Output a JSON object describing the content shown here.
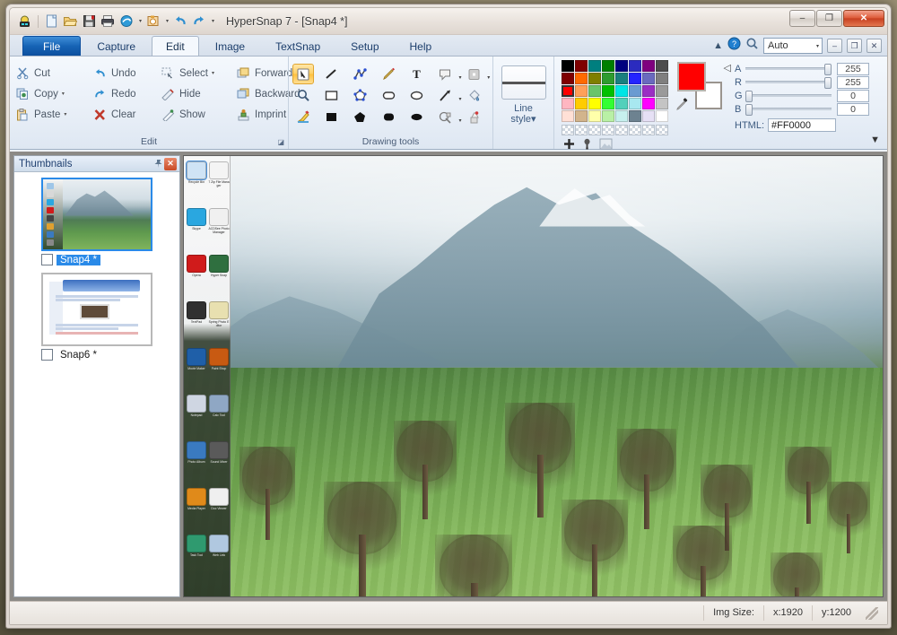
{
  "window": {
    "title": "HyperSnap 7 - [Snap4 *]",
    "app_icon": "hypersnap-app-icon",
    "buttons": {
      "minimize": "–",
      "maximize": "❐",
      "close": "✕"
    }
  },
  "quick_access": [
    {
      "name": "new-icon",
      "glyph": "📄"
    },
    {
      "name": "open-icon",
      "glyph": "📂"
    },
    {
      "name": "save-icon",
      "glyph": "💾"
    },
    {
      "name": "print-icon",
      "glyph": "🖨"
    },
    {
      "name": "capture-window-icon",
      "glyph": "🔵",
      "dropdown": true
    },
    {
      "name": "capture-region-icon",
      "glyph": "🟠",
      "dropdown": true
    },
    {
      "name": "undo-icon",
      "glyph": "↺"
    },
    {
      "name": "redo-icon",
      "glyph": "↻"
    },
    {
      "name": "customize-qat-icon",
      "glyph": "▾"
    }
  ],
  "ribbon": {
    "tabs": [
      {
        "label": "File",
        "state": "file"
      },
      {
        "label": "Capture",
        "state": "normal"
      },
      {
        "label": "Edit",
        "state": "active"
      },
      {
        "label": "Image",
        "state": "normal"
      },
      {
        "label": "TextSnap",
        "state": "normal"
      },
      {
        "label": "Setup",
        "state": "normal"
      },
      {
        "label": "Help",
        "state": "normal"
      }
    ],
    "right_controls": {
      "collapse": "▲",
      "help": "?",
      "zoom_icon": "search-icon",
      "zoom_value": "Auto",
      "mdi_minimize": "–",
      "mdi_restore": "❐",
      "mdi_close": "✕"
    },
    "groups": {
      "edit": {
        "label": "Edit",
        "commands": [
          {
            "label": "Cut",
            "icon": "✂"
          },
          {
            "label": "Undo",
            "icon": "↺"
          },
          {
            "label": "Select",
            "icon": "▣",
            "dropdown": "▾"
          },
          {
            "label": "Forward",
            "icon": "▤"
          },
          {
            "label": "Copy",
            "icon": "⧉",
            "dropdown": "▾"
          },
          {
            "label": "Redo",
            "icon": "↻"
          },
          {
            "label": "Hide",
            "icon": "⬓"
          },
          {
            "label": "Backward",
            "icon": "▥"
          },
          {
            "label": "Paste",
            "icon": "📋",
            "dropdown": "▾"
          },
          {
            "label": "Clear",
            "icon": "✖"
          },
          {
            "label": "Show",
            "icon": "⬒"
          },
          {
            "label": "Imprint",
            "icon": "⬔"
          }
        ]
      },
      "drawing_tools": {
        "label": "Drawing tools",
        "tools": [
          {
            "name": "select-arrow-tool",
            "glyph": "arrow",
            "selected": true
          },
          {
            "name": "line-tool",
            "glyph": "line"
          },
          {
            "name": "polyline-tool",
            "glyph": "polyline"
          },
          {
            "name": "pencil-tool",
            "glyph": "pencil"
          },
          {
            "name": "text-tool",
            "glyph": "T"
          },
          {
            "name": "callout-tool",
            "glyph": "callout",
            "dropdown": true
          },
          {
            "name": "blur-tool",
            "glyph": "blur",
            "dropdown": true
          },
          {
            "name": "magnifier-tool",
            "glyph": "magnifier"
          },
          {
            "name": "rectangle-tool",
            "glyph": "rect"
          },
          {
            "name": "polygon-tool",
            "glyph": "polygon"
          },
          {
            "name": "rounded-rect-tool",
            "glyph": "roundrect"
          },
          {
            "name": "ellipse-tool",
            "glyph": "ellipse"
          },
          {
            "name": "arrow-tool",
            "glyph": "arrowpen",
            "dropdown": true
          },
          {
            "name": "fill-bucket-tool",
            "glyph": "bucket"
          },
          {
            "name": "highlighter-tool",
            "glyph": "highlighter"
          },
          {
            "name": "filled-rect-tool",
            "glyph": "fillrect"
          },
          {
            "name": "filled-polygon-tool",
            "glyph": "fillpolygon"
          },
          {
            "name": "filled-rounded-rect-tool",
            "glyph": "fillroundrect"
          },
          {
            "name": "filled-ellipse-tool",
            "glyph": "fillellipse"
          },
          {
            "name": "stamp-tool",
            "glyph": "stamp",
            "dropdown": true
          },
          {
            "name": "eraser-tool",
            "glyph": "eraser"
          }
        ]
      },
      "line_style": {
        "label_line1": "Line",
        "label_line2": "style",
        "dropdown": "▾"
      },
      "colors": {
        "palette_rows": [
          [
            "#000000",
            "#7f0000",
            "#007f7f",
            "#007f00",
            "#00007f",
            "#2b2bbf",
            "#7f007f",
            "#4d4d4d"
          ],
          [
            "#7f0000",
            "#ff6a00",
            "#7f7f00",
            "#2e9b2e",
            "#1a7f7f",
            "#2424ff",
            "#6a6abf",
            "#7f7f7f"
          ],
          [
            "#ff0000",
            "#ffa05a",
            "#6ac46a",
            "#00c000",
            "#00e5e5",
            "#6a9bd1",
            "#9b2ec4",
            "#9a9a9a"
          ],
          [
            "#ffb6c1",
            "#ffcc00",
            "#ffff00",
            "#33ff33",
            "#52d0bb",
            "#a8e8f0",
            "#ff00ff",
            "#c4c4c4"
          ],
          [
            "#ffe0d6",
            "#d2b48c",
            "#ffffaa",
            "#b9f0a5",
            "#c7f0ee",
            "#6d8290",
            "#e6e0f5",
            "#ffffff"
          ]
        ],
        "transparent_count": 8,
        "foreground": "#FF0000",
        "background": "#FFFFFF",
        "tools": [
          {
            "name": "add-color-icon",
            "glyph": "✛"
          },
          {
            "name": "eyedropper-icon",
            "glyph": "⚲"
          },
          {
            "name": "palette-image-icon",
            "glyph": "▨"
          }
        ],
        "channels": [
          {
            "label": "A",
            "value": "255",
            "pos": 100
          },
          {
            "label": "R",
            "value": "255",
            "pos": 100
          },
          {
            "label": "G",
            "value": "0",
            "pos": 0
          },
          {
            "label": "B",
            "value": "0",
            "pos": 0
          }
        ],
        "html_label": "HTML:",
        "html_value": "#FF0000",
        "more_arrow": "▼"
      }
    }
  },
  "thumbnails_panel": {
    "title": "Thumbnails",
    "pin_icon": "pin-icon",
    "close_icon": "✕",
    "items": [
      {
        "label": "Snap4 *",
        "selected": true,
        "kind": "landscape"
      },
      {
        "label": "Snap6 *",
        "selected": false,
        "kind": "document"
      }
    ]
  },
  "canvas": {
    "document_name": "Snap4 *",
    "desktop_icons": [
      {
        "label": "Recycle Bin",
        "color": "#cfe3f5",
        "selected": true
      },
      {
        "label": "7 Zip File Manager",
        "color": "#f4f4f4"
      },
      {
        "label": "Skype",
        "color": "#2aa7e0"
      },
      {
        "label": "ACDSee Photo Manager",
        "color": "#f0f0f0"
      },
      {
        "label": "Opera",
        "color": "#d01b1b"
      },
      {
        "label": "Hyper Snap",
        "color": "#2f6f3f"
      },
      {
        "label": "TextPad",
        "color": "#303030"
      },
      {
        "label": "Spring Photo Editor",
        "color": "#e8e0b0"
      },
      {
        "label": "Movie Maker",
        "color": "#1f5fa8"
      },
      {
        "label": "Paint Shop",
        "color": "#c85a12"
      },
      {
        "label": "Notepad",
        "color": "#cfd6e2"
      },
      {
        "label": "Calc Tool",
        "color": "#8fa7c4"
      },
      {
        "label": "Photo Album",
        "color": "#3a7ac0"
      },
      {
        "label": "Sound Mixer",
        "color": "#5a5a5a"
      },
      {
        "label": "Media Player",
        "color": "#e08a1a"
      },
      {
        "label": "Doc Viewer",
        "color": "#efefef"
      },
      {
        "label": "Task Tool",
        "color": "#2f9a6f"
      },
      {
        "label": "Web Link",
        "color": "#b0c8e0"
      }
    ]
  },
  "statusbar": {
    "img_size_label": "Img Size:",
    "width": "x:1920",
    "height": "y:1200"
  }
}
